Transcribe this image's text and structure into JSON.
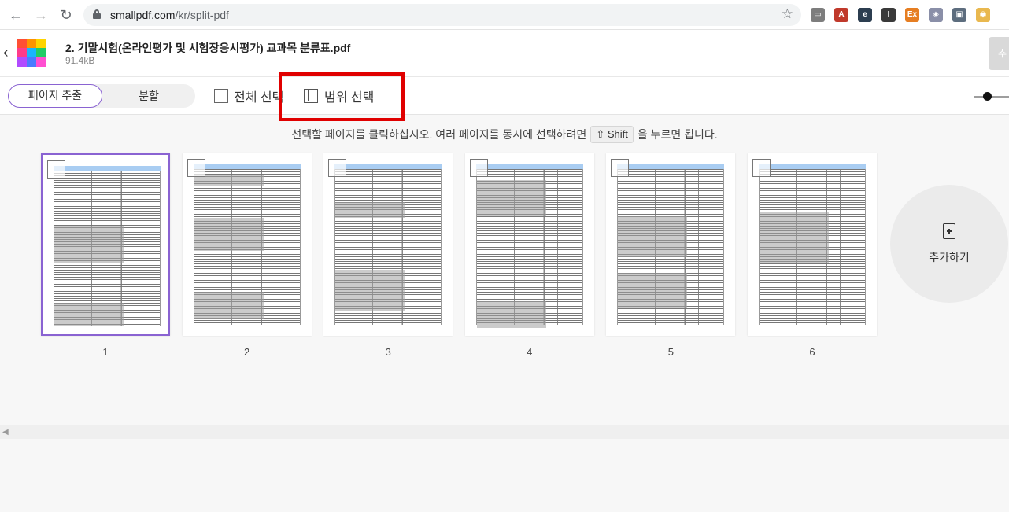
{
  "browser": {
    "url_host": "smallpdf.com",
    "url_path": "/kr/split-pdf",
    "extensions": [
      {
        "name": "cast-icon",
        "color": "#7d7d7d",
        "glyph": "▭"
      },
      {
        "name": "acrobat-icon",
        "color": "#c0392b",
        "glyph": "A"
      },
      {
        "name": "edge-ext-icon",
        "color": "#2c3e50",
        "glyph": "e"
      },
      {
        "name": "instapaper-icon",
        "color": "#3a3a3a",
        "glyph": "I"
      },
      {
        "name": "ex-icon",
        "color": "#e67e22",
        "glyph": "Ex"
      },
      {
        "name": "shield-ext-icon",
        "color": "#8a8fa8",
        "glyph": "◈"
      },
      {
        "name": "screenshot-ext-icon",
        "color": "#5d6d7e",
        "glyph": "▣"
      },
      {
        "name": "eyes-ext-icon",
        "color": "#e9b84f",
        "glyph": "◉"
      }
    ]
  },
  "file": {
    "name": "2. 기말시험(온라인평가 및 시험장응시평가) 교과목 분류표.pdf",
    "size": "91.4kB",
    "finish_label": "추"
  },
  "toolbar": {
    "mode_extract": "페이지 추출",
    "mode_split": "분할",
    "select_all": "전체 선택",
    "range_select": "범위 선택"
  },
  "instruction": {
    "before": "선택할 페이지를 클릭하십시오. 여러 페이지를 동시에 선택하려면",
    "key": "⇧ Shift",
    "after": "을 누르면 됩니다."
  },
  "pages": [
    {
      "number": "1",
      "selected": true
    },
    {
      "number": "2",
      "selected": false
    },
    {
      "number": "3",
      "selected": false
    },
    {
      "number": "4",
      "selected": false
    },
    {
      "number": "5",
      "selected": false
    },
    {
      "number": "6",
      "selected": false
    }
  ],
  "add_card": {
    "label": "추가하기"
  },
  "colors": {
    "accent": "#8a63d2",
    "highlight": "#e00000"
  }
}
